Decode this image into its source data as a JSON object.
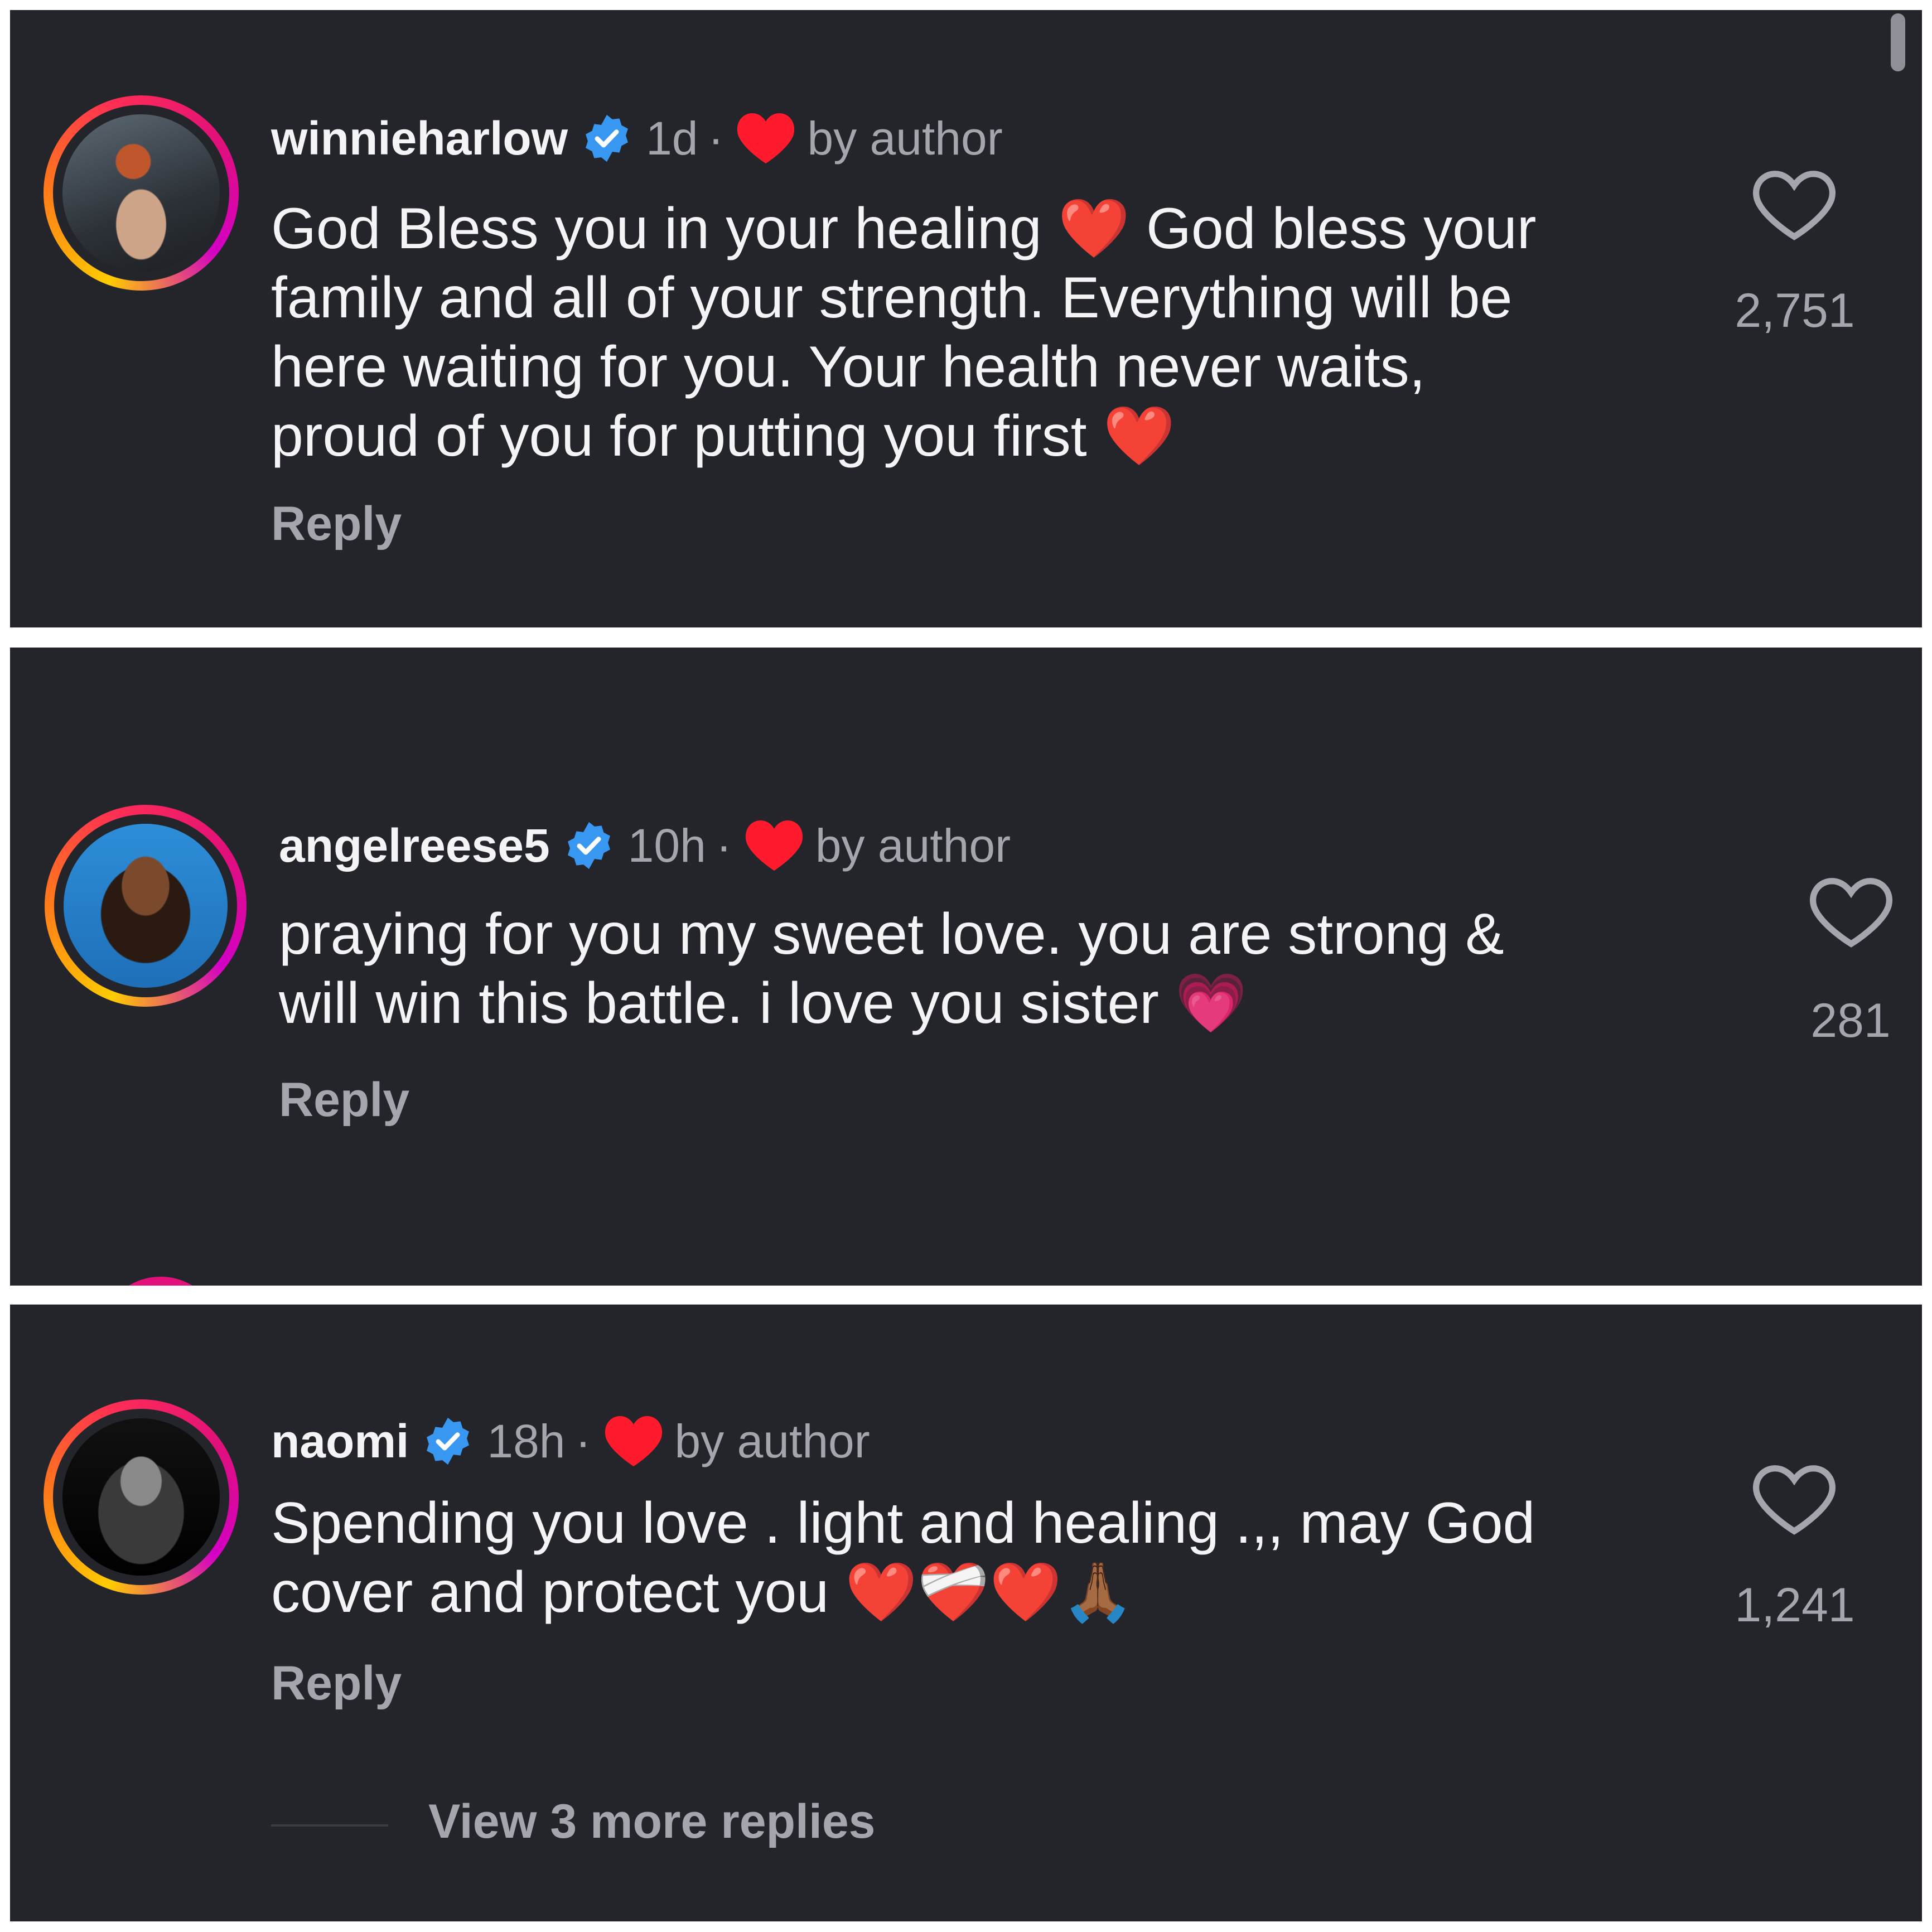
{
  "colors": {
    "background": "#23252b",
    "text": "#f4f4f6",
    "muted": "#a3a6ad",
    "verified": "#3897f0",
    "author_heart": "#ff1b2d"
  },
  "comments": [
    {
      "username": "winnieharlow",
      "time": "1d",
      "separator": "·",
      "by_author": "by author",
      "text": "God Bless you in your healing ❤️ God bless your\nfamily and all of your strength. Everything will be\nhere waiting for you. Your health never waits,\nproud of you for putting you first ❤️",
      "reply": "Reply",
      "likes": "2,751"
    },
    {
      "username": "angelreese5",
      "time": "10h",
      "separator": "·",
      "by_author": "by author",
      "text": "praying for you my sweet love. you are strong &\nwill win this battle. i love you sister 💗",
      "reply": "Reply",
      "likes": "281"
    },
    {
      "username": "naomi",
      "time": "18h",
      "separator": "·",
      "by_author": "by author",
      "text": "Spending you love . light and  healing .,, may God\ncover and protect you ❤️❤️‍🩹❤️🙏🏾",
      "reply": "Reply",
      "likes": "1,241"
    }
  ],
  "view_more_replies": "View 3 more replies",
  "icons": [
    "verified-badge-icon",
    "author-heart-icon",
    "like-heart-icon",
    "avatar"
  ]
}
